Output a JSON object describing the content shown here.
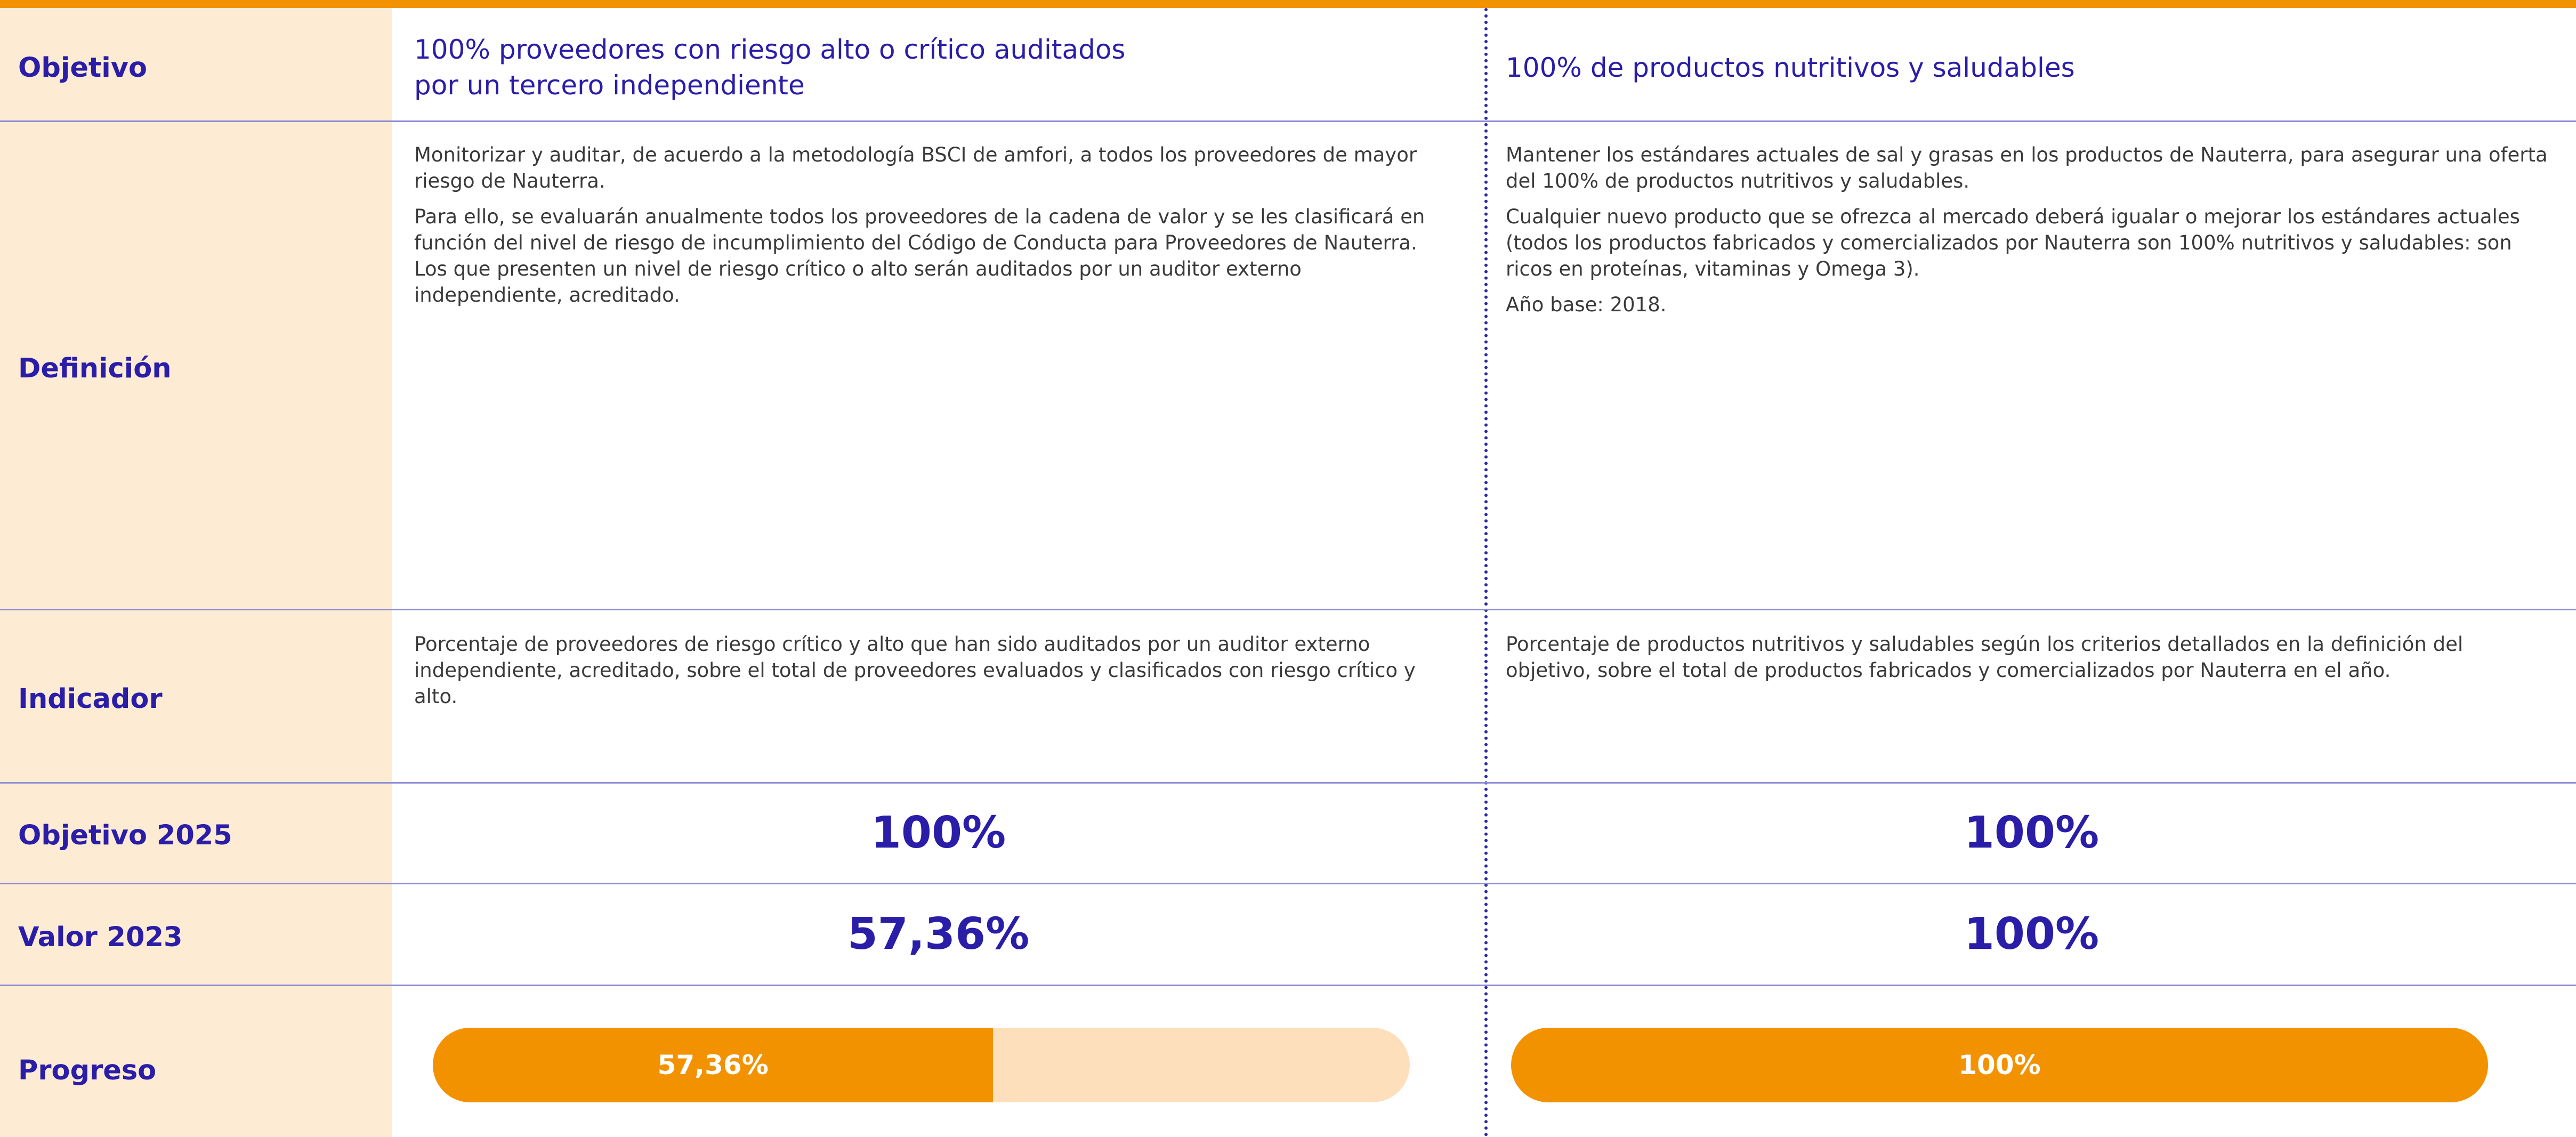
{
  "row_labels": {
    "objetivo": "Objetivo",
    "definicion": "Definición",
    "indicador": "Indicador",
    "objetivo_2025": "Objetivo 2025",
    "valor_2023": "Valor 2023",
    "progreso": "Progreso"
  },
  "columns": [
    {
      "title_line1": "100% proveedores con riesgo alto o crítico auditados",
      "title_line2": "por un tercero independiente",
      "definition": [
        "Monitorizar y auditar, de acuerdo a la metodología BSCI de amfori, a todos los proveedores de mayor riesgo de Nauterra.",
        "Para ello, se evaluarán anualmente todos los proveedores de la cadena de valor y se les clasificará en función del nivel de riesgo de incumplimiento del Código de Conducta para Proveedores de Nauterra. Los que presenten un nivel de riesgo crítico o alto serán auditados por un auditor externo independiente, acreditado."
      ],
      "indicator": "Porcentaje de proveedores de riesgo crítico y alto que han sido auditados por un auditor externo independiente, acreditado, sobre el total de proveedores evaluados y clasificados con riesgo crítico y alto.",
      "objetivo_2025": "100%",
      "valor_2023": "57,36%",
      "progress_label": "57,36%",
      "progress_fraction": 0.5736
    },
    {
      "title_line1": "100% de productos nutritivos y saludables",
      "title_line2": "",
      "definition": [
        "Mantener los estándares actuales de sal y grasas en los productos de Nauterra, para asegurar una oferta del 100% de productos nutritivos y saludables.",
        "Cualquier nuevo producto que se ofrezca al mercado deberá igualar o mejorar los estándares actuales (todos los productos fabricados y comercializados por Nauterra son 100% nutritivos y saludables: son ricos en proteínas, vitaminas y Omega 3).",
        "Año base: 2018."
      ],
      "indicator": "Porcentaje de productos nutritivos y saludables según los criterios detallados en la definición del objetivo, sobre el total de productos fabricados y comercializados por Nauterra en el año.",
      "objetivo_2025": "100%",
      "valor_2023": "100%",
      "progress_label": "100%",
      "progress_fraction": 1.0
    }
  ],
  "colors": {
    "accent_orange": "#f39200",
    "track_light": "#fde0bb",
    "label_background": "#fdebd3",
    "heading_blue": "#2a1da8"
  }
}
